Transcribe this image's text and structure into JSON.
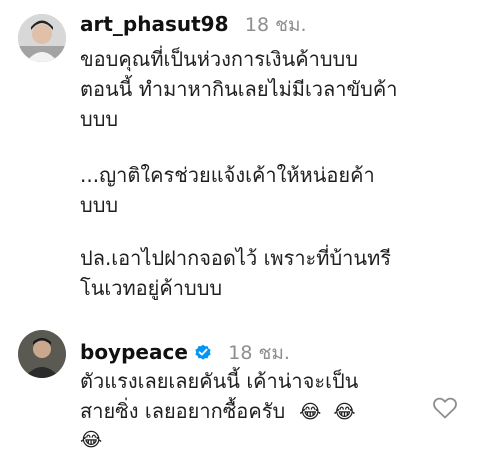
{
  "comments": [
    {
      "username": "art_phasut98",
      "time": "18 ชม.",
      "lines": [
        "ขอบคุณที่เป็นห่วงการเงินค้าบบบ",
        "ตอนนี้ ทำมาหากินเลยไม่มีเวลาขับค้า",
        "บบบ",
        "...ญาติใครช่วยแจ้งเค้าให้หน่อยค้า",
        "บบบ",
        "ปล.เอาไปฝากจอดไว้ เพราะที่บ้านทรี",
        "โนเวทอยู่ค้าบบบ"
      ]
    },
    {
      "username": "boypeace",
      "time": "18 ชม.",
      "verified": true,
      "lines": [
        "ตัวแรงเลยเลยคันนี้ เค้าน่าจะเป็น",
        "สายซิ่ง เลยอยากซื้อครับ"
      ],
      "emojis": [
        "😂",
        "😂",
        "😂"
      ]
    }
  ],
  "icons": {
    "verified": "verified-badge-icon",
    "like": "heart-icon"
  },
  "colors": {
    "verified_blue": "#0095f6",
    "muted_text": "#8e8e8e"
  }
}
